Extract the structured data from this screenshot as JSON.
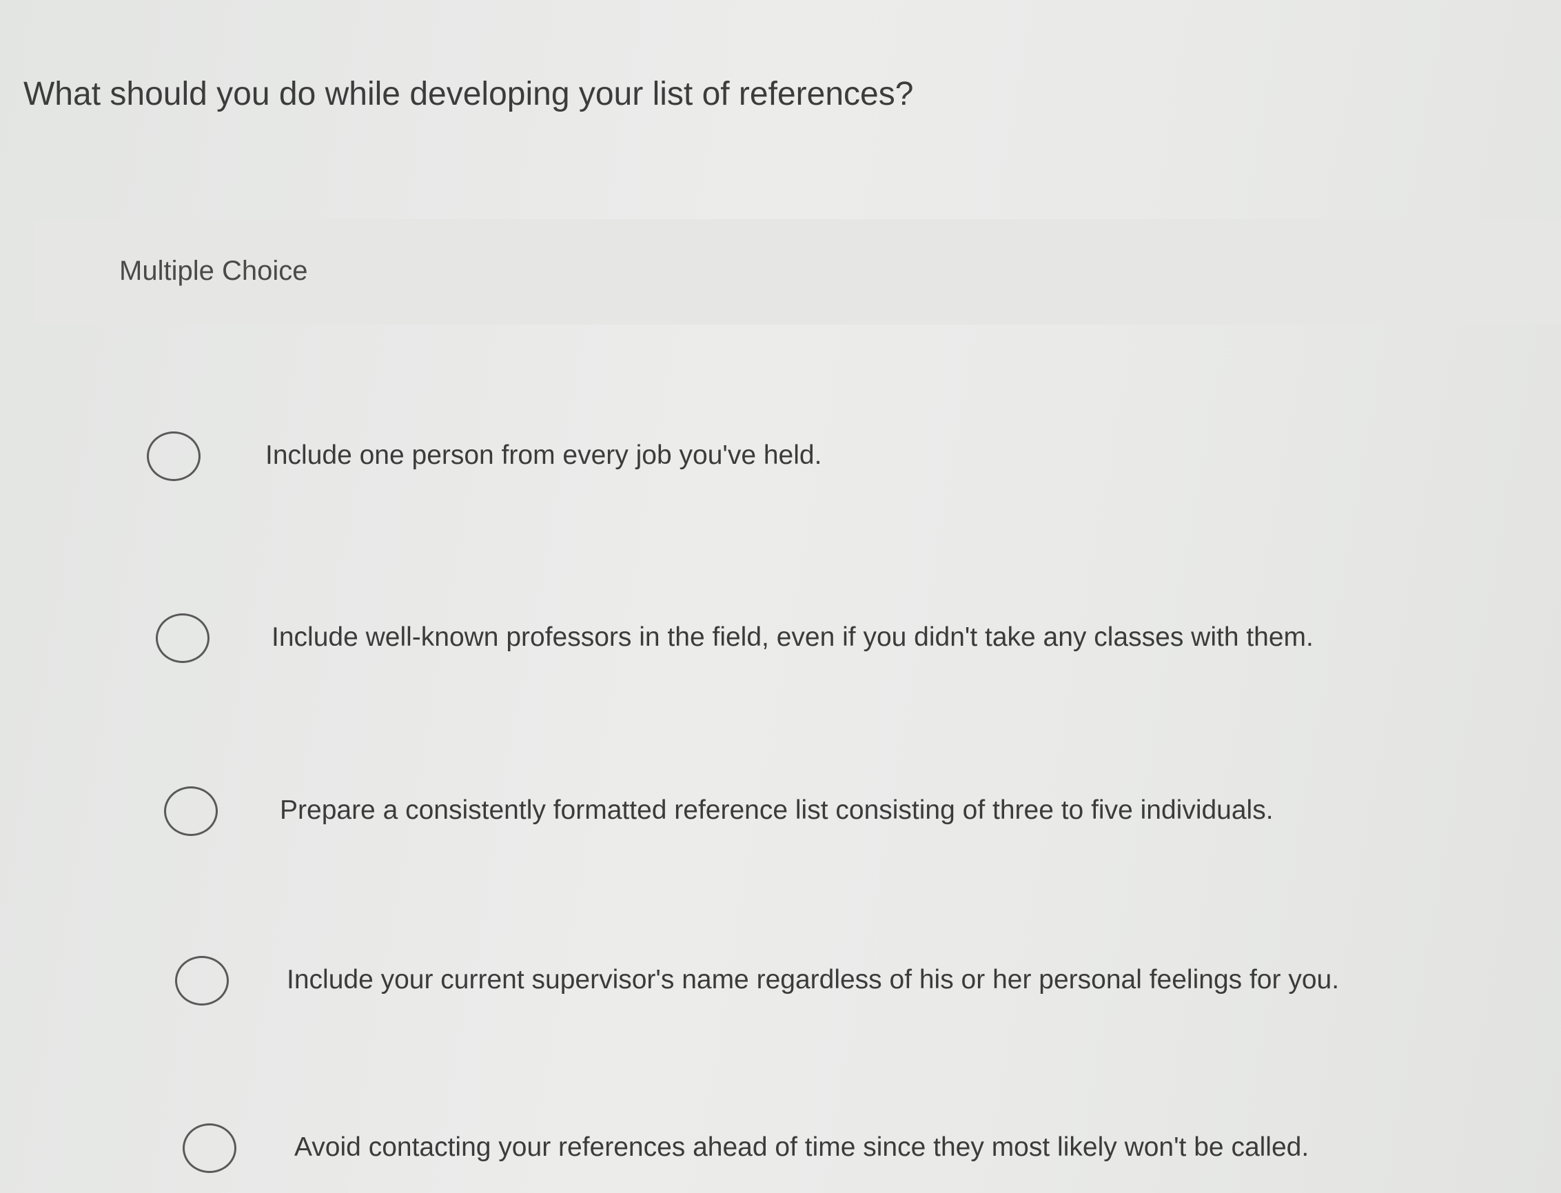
{
  "question": {
    "text": "What should you do while developing your list of references?"
  },
  "question_type": {
    "label": "Multiple Choice"
  },
  "options": [
    {
      "label": "Include one person from every job you've held.",
      "selected": false
    },
    {
      "label": "Include well-known professors in the field, even if you didn't take any classes with them.",
      "selected": false
    },
    {
      "label": "Prepare a consistently formatted reference list consisting of three to five individuals.",
      "selected": false
    },
    {
      "label": "Include your current supervisor's name regardless of his or her personal feelings for you.",
      "selected": false
    },
    {
      "label": "Avoid contacting your references ahead of time since they most likely won't be called.",
      "selected": false
    }
  ]
}
